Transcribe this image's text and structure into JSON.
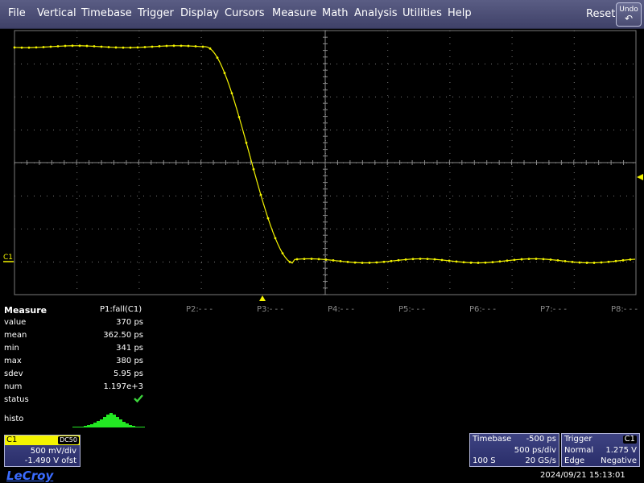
{
  "menu": [
    "File",
    "Vertical",
    "Timebase",
    "Trigger",
    "Display",
    "Cursors",
    "Measure",
    "Math",
    "Analysis",
    "Utilities",
    "Help"
  ],
  "reset_label": "Reset",
  "undo_label": "Undo",
  "channel_marker": "C1",
  "trace_color": "#f4f400",
  "measure": {
    "title": "Measure",
    "p1_label": "P1:fall(C1)",
    "params": [
      "P2:- - -",
      "P3:- - -",
      "P4:- - -",
      "P5:- - -",
      "P6:- - -",
      "P7:- - -",
      "P8:- - -"
    ],
    "rows": [
      {
        "label": "value",
        "value": "370 ps"
      },
      {
        "label": "mean",
        "value": "362.50 ps"
      },
      {
        "label": "min",
        "value": "341 ps"
      },
      {
        "label": "max",
        "value": "380 ps"
      },
      {
        "label": "sdev",
        "value": "5.95 ps"
      },
      {
        "label": "num",
        "value": "1.197e+3"
      }
    ],
    "status_label": "status",
    "histo_label": "histo"
  },
  "c1": {
    "label": "C1",
    "coupling": "DC50",
    "vdiv": "500 mV/div",
    "offset": "-1.490 V ofst"
  },
  "timebase": {
    "label": "Timebase",
    "delay": "-500 ps",
    "per_div": "500 ps/div",
    "samples": "100 S",
    "rate": "20 GS/s"
  },
  "trigger": {
    "label": "Trigger",
    "channel": "C1",
    "mode": "Normal",
    "level": "1.275 V",
    "type": "Edge",
    "slope": "Negative"
  },
  "brand": "LeCroy",
  "timestamp": "2024/09/21 15:13:01"
}
